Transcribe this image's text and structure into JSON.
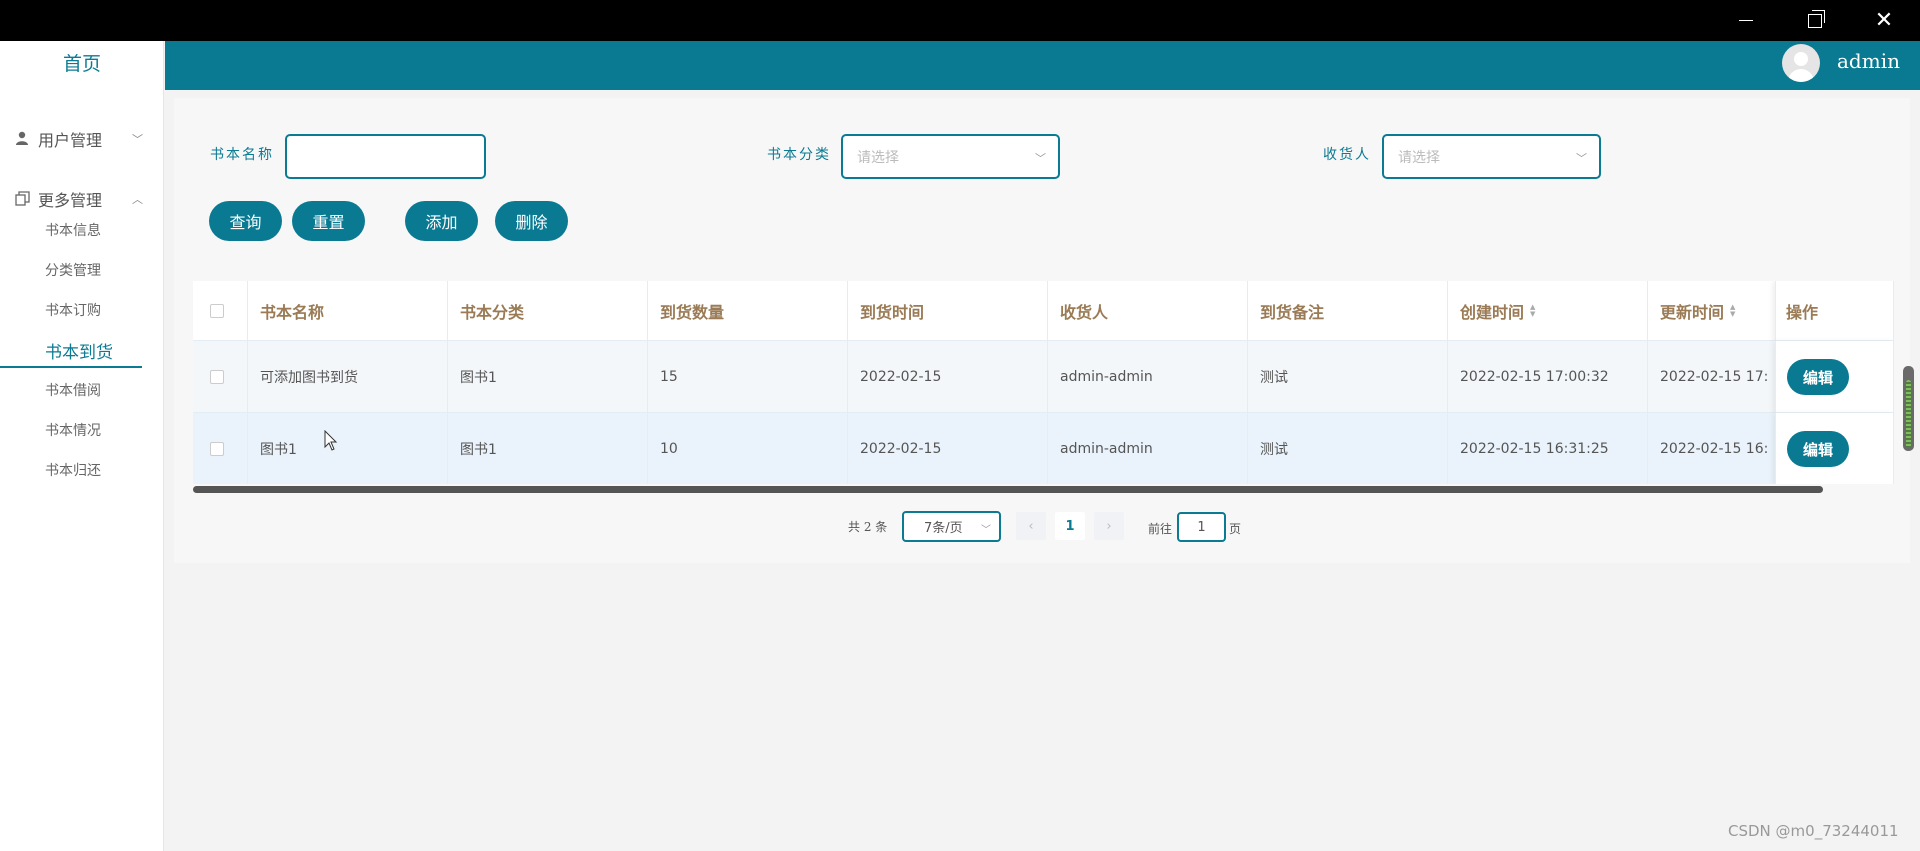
{
  "window": {
    "minimize": "minimize",
    "maximize": "maximize",
    "close": "close"
  },
  "sidebar": {
    "home": "首页",
    "groups": [
      {
        "label": "用户管理",
        "icon": "user-icon",
        "expanded": false
      },
      {
        "label": "更多管理",
        "icon": "copy-icon",
        "expanded": true
      }
    ],
    "items": [
      "书本信息",
      "分类管理",
      "书本订购",
      "书本到货",
      "书本借阅",
      "书本情况",
      "书本归还"
    ],
    "active": "书本到货"
  },
  "header": {
    "username": "admin",
    "color": "#0a7a93"
  },
  "filters": {
    "name_label": "书本名称",
    "name_value": "",
    "category_label": "书本分类",
    "category_placeholder": "请选择",
    "receiver_label": "收货人",
    "receiver_placeholder": "请选择"
  },
  "buttons": {
    "query": "查询",
    "reset": "重置",
    "add": "添加",
    "delete": "删除"
  },
  "table": {
    "columns": [
      "书本名称",
      "书本分类",
      "到货数量",
      "到货时间",
      "收货人",
      "到货备注",
      "创建时间",
      "更新时间",
      "操作"
    ],
    "rows": [
      {
        "name": "可添加图书到货",
        "category": "图书1",
        "qty": "15",
        "date": "2022-02-15",
        "receiver": "admin-admin",
        "note": "测试",
        "created": "2022-02-15 17:00:32",
        "updated": "2022-02-15 17:",
        "action": "编辑"
      },
      {
        "name": "图书1",
        "category": "图书1",
        "qty": "10",
        "date": "2022-02-15",
        "receiver": "admin-admin",
        "note": "测试",
        "created": "2022-02-15 16:31:25",
        "updated": "2022-02-15 16:",
        "action": "编辑"
      }
    ]
  },
  "pagination": {
    "total": "共 2 条",
    "page_size": "7条/页",
    "current_page": "1",
    "goto_label": "前往",
    "goto_value": "1",
    "page_suffix": "页"
  },
  "watermark": "CSDN @m0_73244011"
}
